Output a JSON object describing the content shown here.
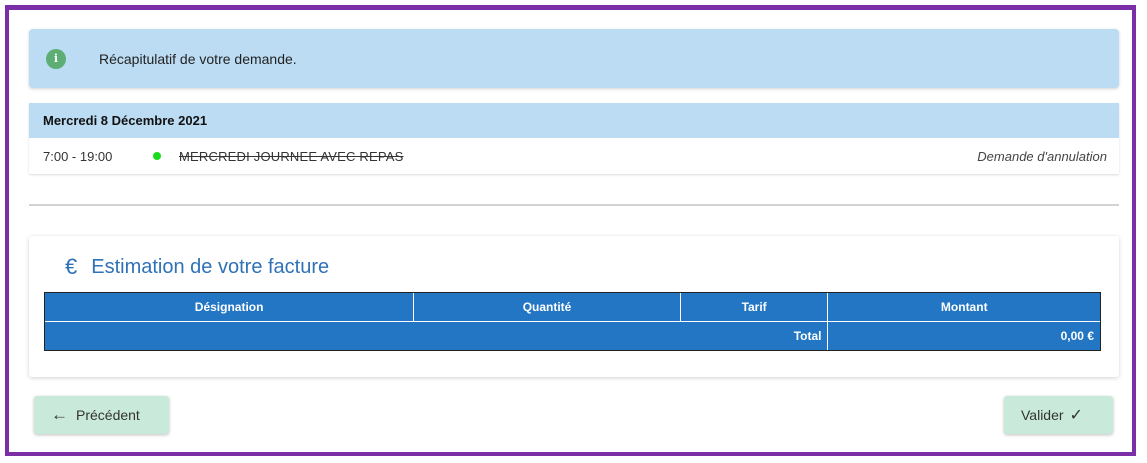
{
  "banner": {
    "icon": "info-icon",
    "icon_glyph": "i",
    "text": "Récapitulatif de votre demande."
  },
  "day": {
    "date": "Mercredi 8 Décembre 2021",
    "row": {
      "time": "7:00 - 19:00",
      "status_color": "#1bdc1b",
      "activity": "MERCREDI JOURNEE AVEC REPAS",
      "status": "Demande d'annulation"
    }
  },
  "invoice": {
    "title": "Estimation de votre facture",
    "icon": "euro-icon",
    "icon_glyph": "€",
    "columns": [
      "Désignation",
      "Quantité",
      "Tarif",
      "Montant"
    ],
    "total_label": "Total",
    "total_value": "0,00 €"
  },
  "buttons": {
    "previous": "Précédent",
    "previous_icon": "←",
    "submit": "Valider",
    "submit_icon": "✓"
  },
  "colors": {
    "accent": "#2f72b8",
    "table_header": "#2276c4",
    "banner_bg": "#bcdcf3",
    "button_bg": "#c9eadb",
    "frame": "#7b2fa6"
  }
}
